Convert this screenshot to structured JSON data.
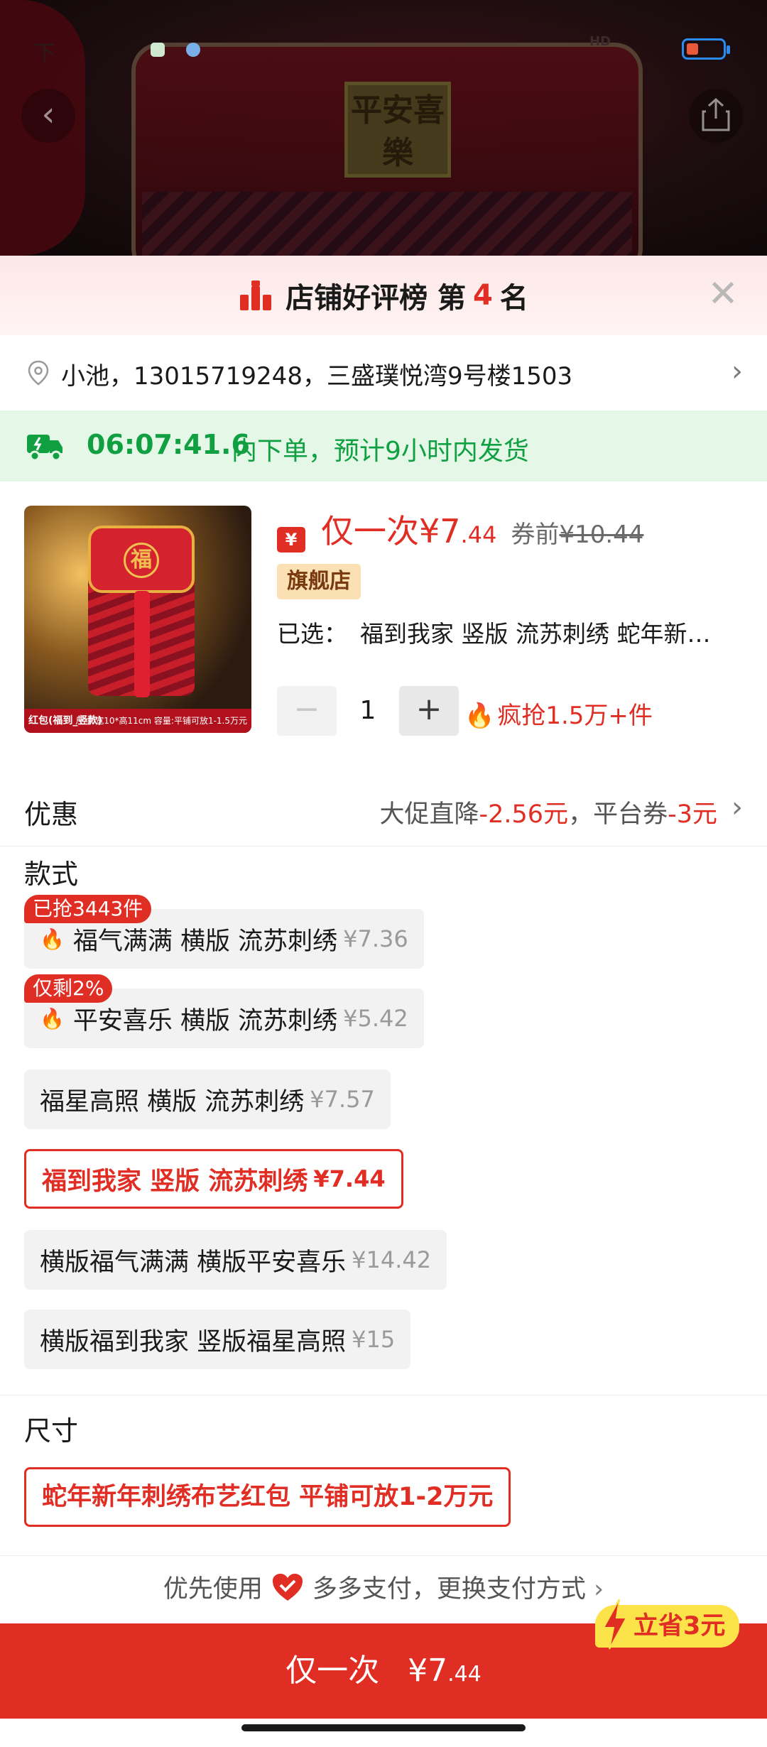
{
  "status_bar": {
    "left_text": "下"
  },
  "hero": {
    "stamp_text": "平安喜樂"
  },
  "rank_banner": {
    "prefix": "店铺好评榜 第",
    "rank": "4",
    "suffix": "名"
  },
  "address": {
    "text": "小池，13015719248，三盛璞悦湾9号楼1503"
  },
  "shipping": {
    "countdown": "06:07:41.6",
    "note": "内下单，预计9小时内发货"
  },
  "product": {
    "image_fu": "福",
    "image_caption_left": "红包(福到_竖款)",
    "image_caption_right": "尺寸:宽10*高11cm 容量:平铺可放1-1.5万元",
    "coupon_icon": "¥",
    "price_prefix": "仅一次¥7",
    "price_decimal": ".44",
    "price_before_label": "券前",
    "price_before_value": "¥10.44",
    "badge": "旗舰店",
    "selected_label": "已选：",
    "selected_value": "福到我家 竖版 流苏刺绣 蛇年新…",
    "quantity": "1",
    "hot_text": "疯抢1.5万+件"
  },
  "promo": {
    "label": "优惠",
    "part1": "大促直降",
    "val1": "-2.56元",
    "sep": "，平台券",
    "val2": "-3元"
  },
  "style_section": {
    "title": "款式",
    "options": [
      {
        "tag": "已抢3443件",
        "label": "福气满满 横版 流苏刺绣",
        "price": "¥7.36"
      },
      {
        "tag": "仅剩2%",
        "label": "平安喜乐 横版 流苏刺绣",
        "price": "¥5.42"
      },
      {
        "label": "福星高照 横版 流苏刺绣",
        "price": "¥7.57"
      },
      {
        "label": "福到我家 竖版 流苏刺绣",
        "price": "¥7.44",
        "selected": true
      },
      {
        "label": "横版福气满满 横版平安喜乐",
        "price": "¥14.42"
      },
      {
        "label": "横版福到我家 竖版福星高照",
        "price": "¥15"
      }
    ]
  },
  "size_section": {
    "title": "尺寸",
    "option": "蛇年新年刺绣布艺红包 平铺可放1-2万元"
  },
  "payment": {
    "prefix": "优先使用",
    "text": "多多支付，更换支付方式"
  },
  "save_badge": "立省3元",
  "buy_button": {
    "label": "仅一次",
    "price_int": "¥7",
    "price_decimal": ".44"
  },
  "colors": {
    "accent": "#e02e24",
    "green": "#10a042",
    "badge_bg": "#fbe0b4"
  },
  "icons": [
    "back-icon",
    "share-icon",
    "close-icon",
    "location-pin-icon",
    "chevron-right-icon",
    "truck-icon",
    "flame-icon",
    "heart-shield-icon",
    "bolt-icon"
  ]
}
